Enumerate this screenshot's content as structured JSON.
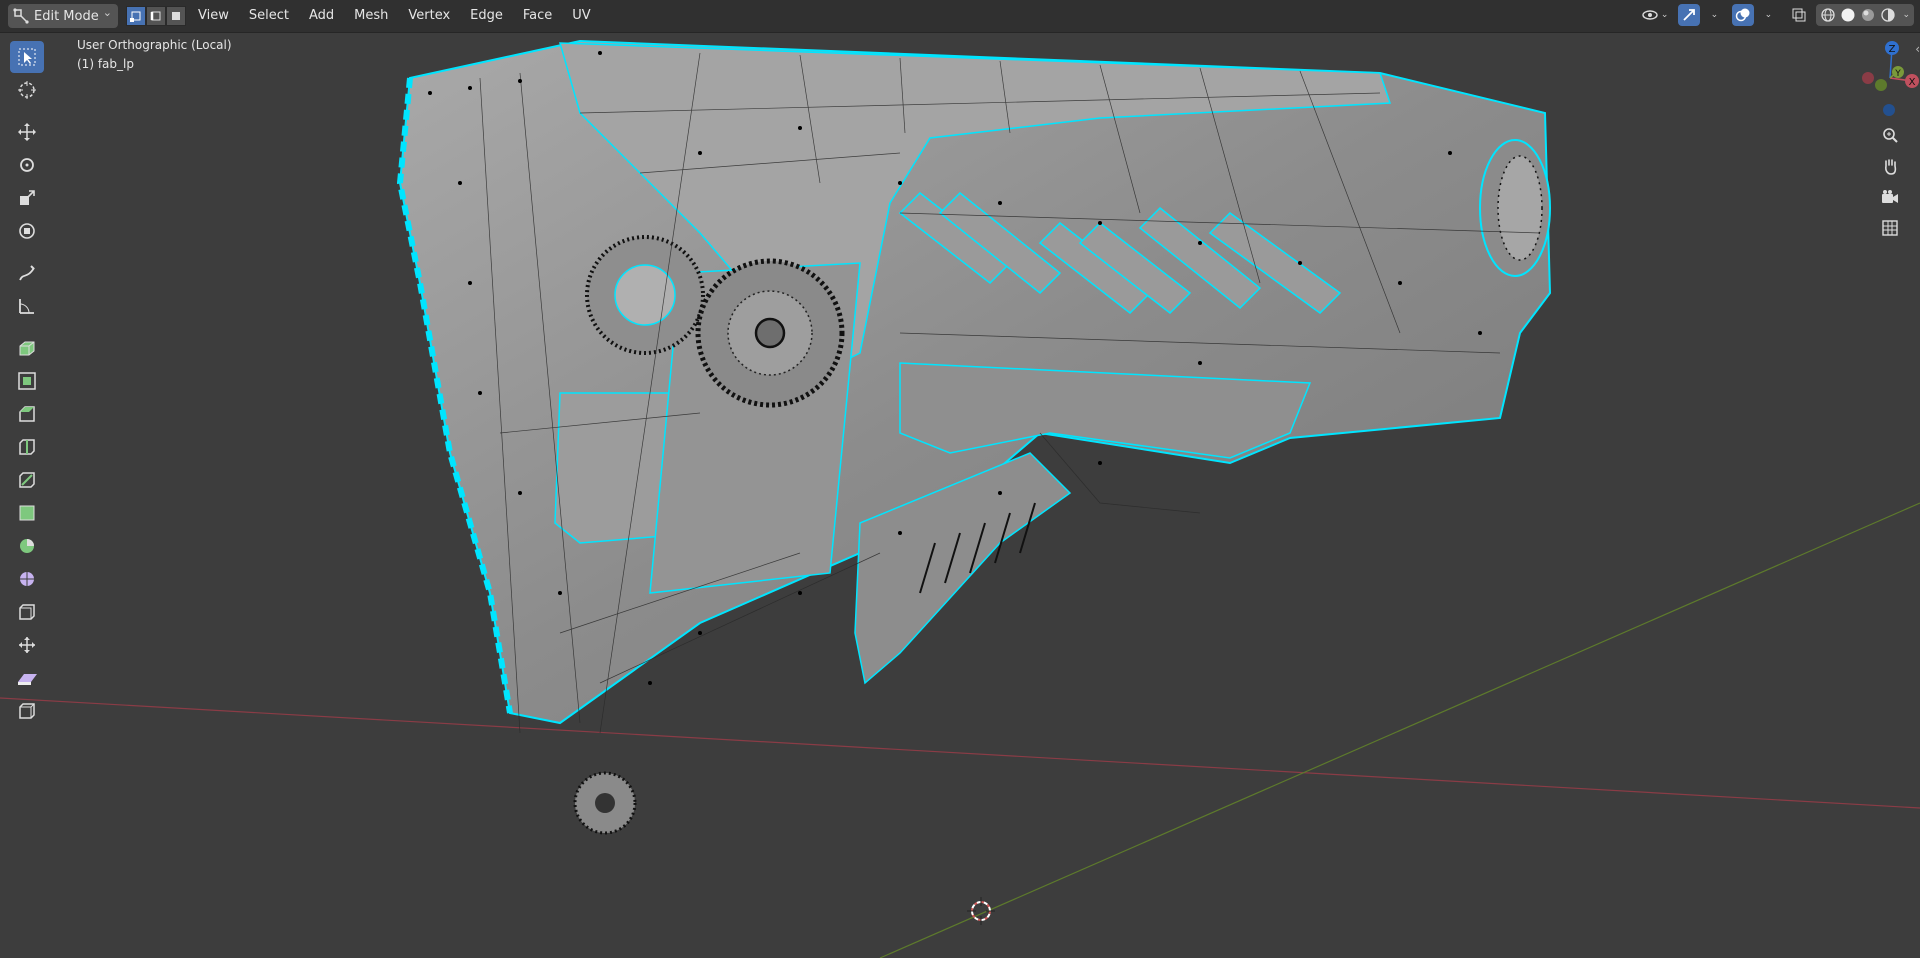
{
  "header": {
    "mode_label": "Edit Mode",
    "menus": [
      "View",
      "Select",
      "Add",
      "Mesh",
      "Vertex",
      "Edge",
      "Face",
      "UV"
    ]
  },
  "viewport": {
    "view_name": "User Orthographic (Local)",
    "object_label": "(1) fab_lp"
  },
  "gizmo": {
    "z": "Z",
    "y": "Y",
    "x": "X"
  },
  "toolbar_icons": [
    "select-box-icon",
    "cursor-icon",
    "move-icon",
    "rotate-icon",
    "scale-icon",
    "transform-icon",
    "annotate-icon",
    "measure-icon",
    "extrude-icon",
    "inset-icon",
    "bevel-icon",
    "loop-cut-icon",
    "knife-icon",
    "poly-build-icon",
    "spin-icon",
    "smooth-icon",
    "edge-slide-icon",
    "shrink-fatten-icon",
    "shear-icon",
    "rip-icon"
  ],
  "colors": {
    "accent": "#4772b3",
    "edge_select": "#00e5ff",
    "x_axis": "#c0505e",
    "y_axis": "#7a9a3a",
    "z_axis": "#2f70d0"
  }
}
